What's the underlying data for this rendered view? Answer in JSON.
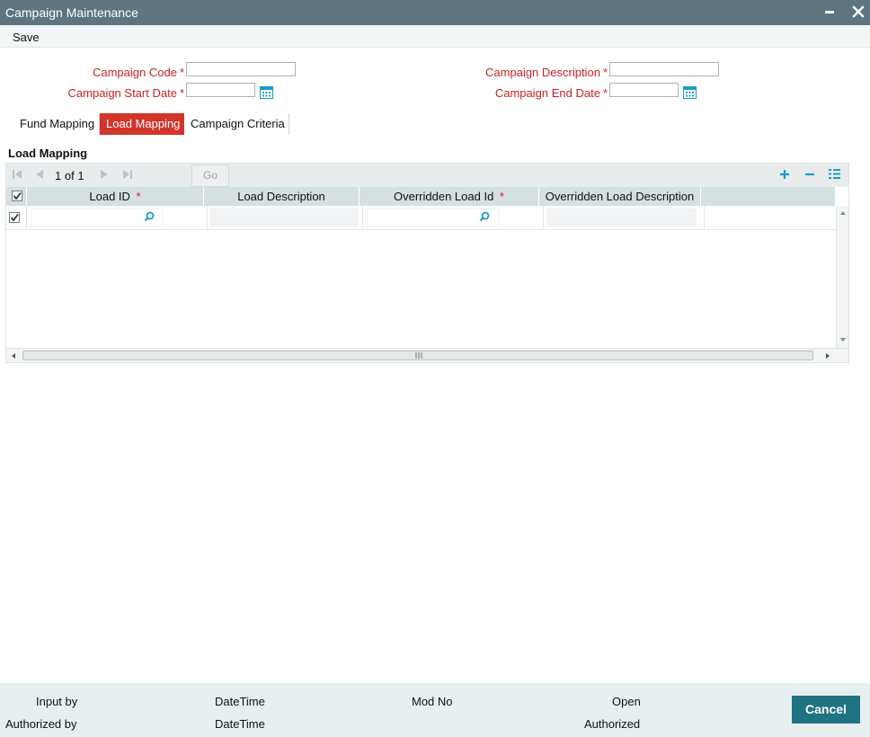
{
  "window": {
    "title": "Campaign Maintenance"
  },
  "menu": {
    "save_label": "Save"
  },
  "form": {
    "campaign_code_label": "Campaign Code",
    "campaign_code_value": "",
    "campaign_description_label": "Campaign Description",
    "campaign_description_value": "",
    "campaign_start_date_label": "Campaign Start Date",
    "campaign_start_date_value": "",
    "campaign_end_date_label": "Campaign End Date",
    "campaign_end_date_value": "",
    "required_mark": "*"
  },
  "tabs": [
    {
      "label": "Fund Mapping",
      "active": false
    },
    {
      "label": "Load Mapping",
      "active": true
    },
    {
      "label": "Campaign Criteria",
      "active": false
    }
  ],
  "section": {
    "title": "Load Mapping"
  },
  "grid": {
    "pager": {
      "current": "1",
      "of_label": "of",
      "total": "1"
    },
    "go_label": "Go",
    "columns": [
      {
        "label": "Load ID",
        "required": true
      },
      {
        "label": "Load Description",
        "required": false
      },
      {
        "label": "Overridden Load Id",
        "required": true
      },
      {
        "label": "Overridden Load Description",
        "required": false
      }
    ],
    "rows": [
      {
        "checked": true,
        "load_id": "",
        "load_description": "",
        "overridden_load_id": "",
        "overridden_load_description": ""
      }
    ],
    "header_checked": true
  },
  "footer": {
    "input_by_label": "Input by",
    "authorized_by_label": "Authorized by",
    "datetime_label_1": "DateTime",
    "datetime_label_2": "DateTime",
    "mod_no_label": "Mod No",
    "open_label": "Open",
    "authorized_label": "Authorized",
    "cancel_label": "Cancel"
  },
  "colors": {
    "title_bar": "#5e7580",
    "active_tab": "#d2352a",
    "required_label": "#cc2222",
    "accent_icon": "#1a9bc6",
    "cancel_button": "#1e7482"
  }
}
